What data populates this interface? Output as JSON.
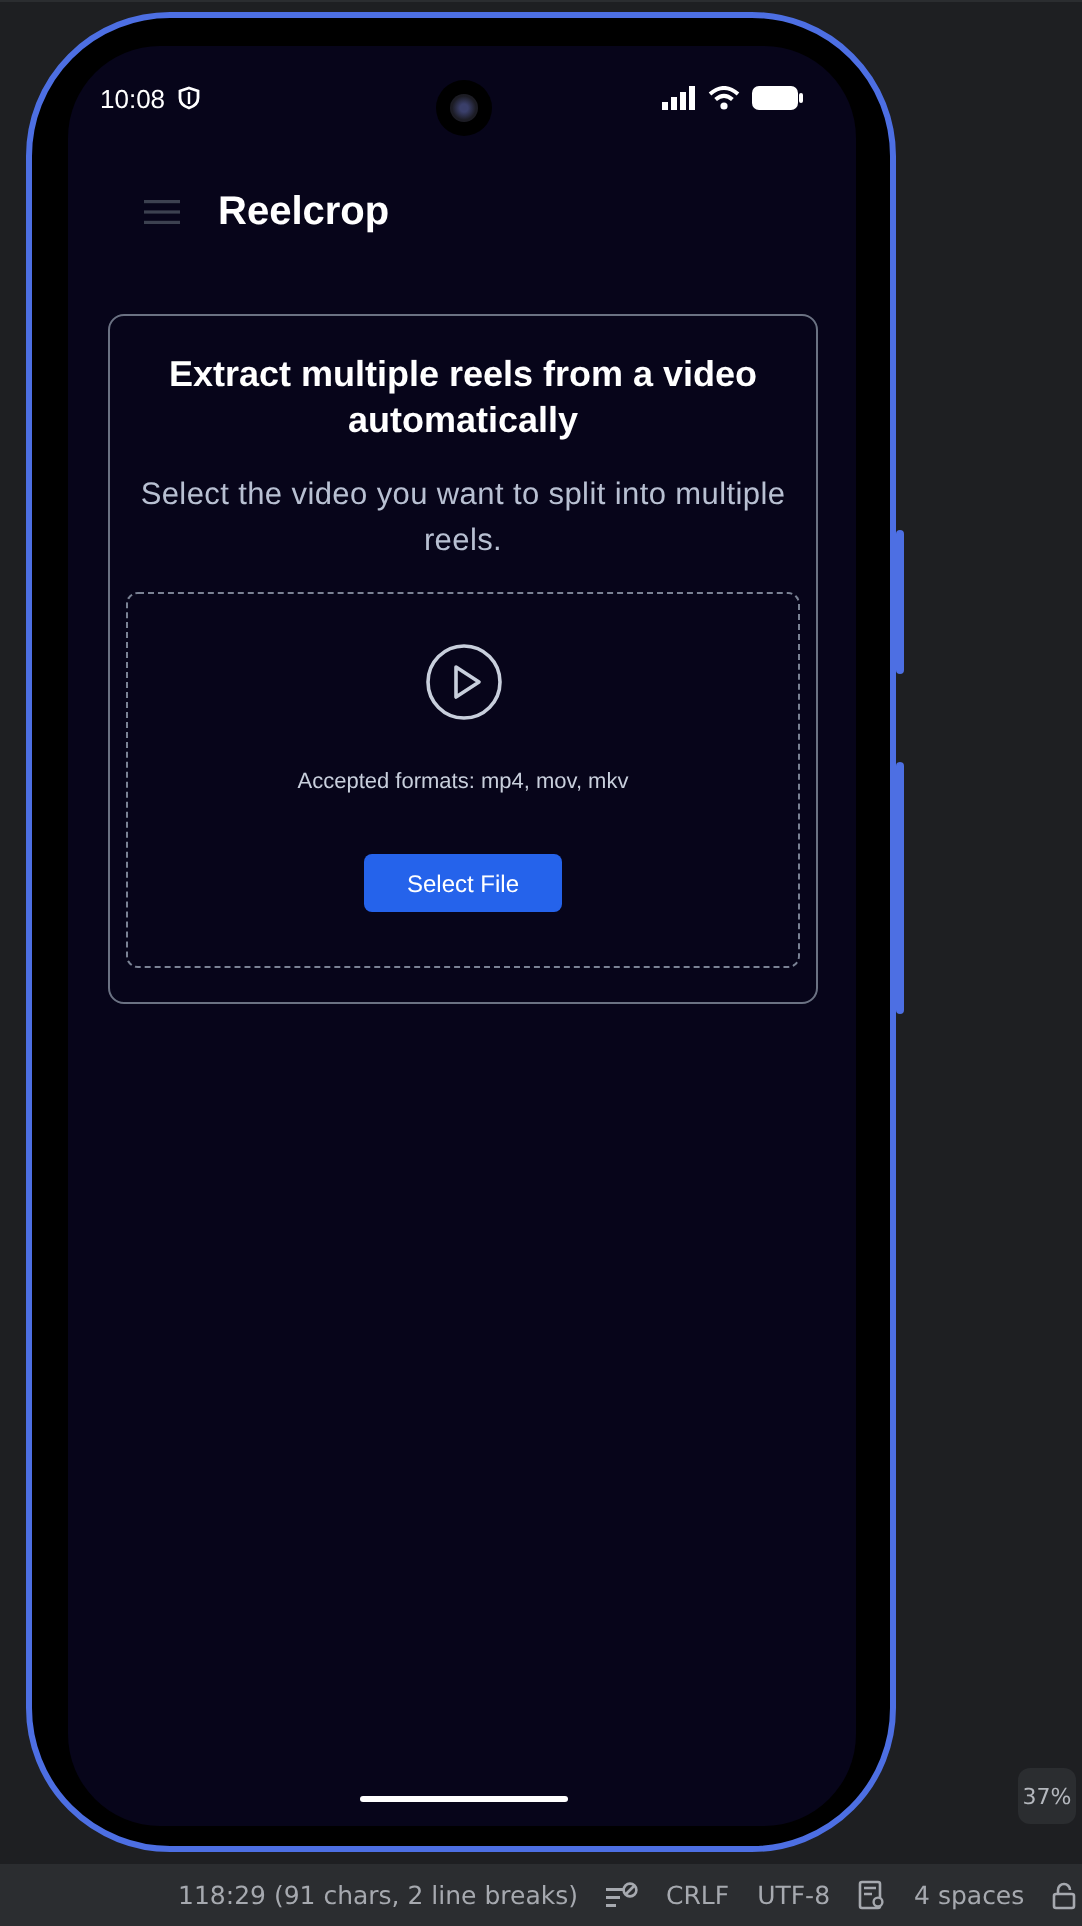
{
  "phone": {
    "status_bar": {
      "time": "10:08"
    },
    "app_bar": {
      "title": "Reelcrop"
    },
    "card": {
      "title": "Extract multiple reels from a video automatically",
      "subtitle": "Select the video you want to split into multiple reels.",
      "dropzone": {
        "formats": "Accepted formats: mp4, mov, mkv",
        "button": "Select File"
      }
    }
  },
  "zoom_badge": "37%",
  "editor_status_bar": {
    "position": "118:29 (91 chars, 2 line breaks)",
    "line_separator": "CRLF",
    "encoding": "UTF-8",
    "indent": "4 spaces"
  }
}
